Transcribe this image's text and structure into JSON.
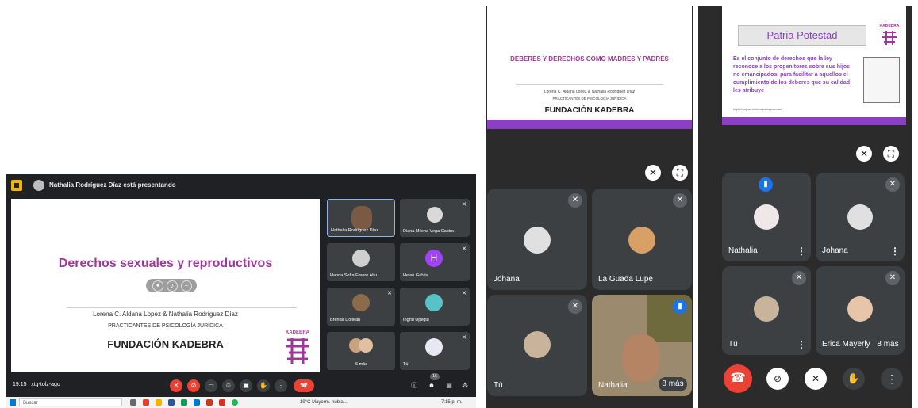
{
  "panel1": {
    "presenting_text": "Nathalia Rodríguez Díaz está presentando",
    "slide": {
      "title": "Derechos sexuales y reproductivos",
      "authors": "Lorena C. Aldana Lopez & Nathalia Rodríguez Díaz",
      "subtitle": "PRACTICANTES DE PSICOLOGÍA JURÍDICA",
      "foundation": "FUNDACIÓN KADEBRA",
      "logo_text": "KADEBRA"
    },
    "participants": [
      {
        "name": "Nathalia Rodríguez Díaz"
      },
      {
        "name": "Diana Milena Vega Castro"
      },
      {
        "name": "Hanna Sofía Forero Ahu..."
      },
      {
        "name": "Helen Galvis",
        "initial": "H"
      },
      {
        "name": "Brenda Doitean"
      },
      {
        "name": "Ingrid Upegui"
      },
      {
        "name": "6 más"
      },
      {
        "name": "Tú"
      }
    ],
    "bottom_bar": {
      "time_meeting": "19:15 | xtg-tolz-ago",
      "badge": "16"
    },
    "taskbar": {
      "search": "Buscar",
      "weather": "19°C Mayorm. nubla...",
      "clock": "7:15 p. m."
    }
  },
  "panel2": {
    "slide": {
      "title": "DEBERES Y DERECHOS COMO MADRES Y PADRES",
      "authors": "Lorena C. Aldana Lopez & Nathalia Rodríguez Díaz",
      "subtitle": "PRACTICANTES DE PSICOLOGÍA JURÍDICA",
      "foundation": "FUNDACIÓN KADEBRA"
    },
    "tiles": [
      {
        "name": "Johana"
      },
      {
        "name": "La Guada Lupe"
      },
      {
        "name": "Tú"
      },
      {
        "name": "Nathalia"
      }
    ],
    "more": "8 más"
  },
  "panel3": {
    "slide": {
      "title": "Patria Potestad",
      "logo_text": "KADEBRA",
      "body": "Es el conjunto de derechos que la ley reconoce a los progenitores sobre sus hijos no emancipados, para facilitar a aquellos el cumplimiento de los deberes que su calidad les atribuye",
      "source": "https://dpej.rae.es/lema/patria-potestad"
    },
    "tiles": [
      {
        "name": "Nathalia"
      },
      {
        "name": "Johana"
      },
      {
        "name": "Tú"
      },
      {
        "name": "Erica Mayerly"
      }
    ],
    "more": "8 más"
  },
  "colors": {
    "brand_purple": "#a0379c",
    "end_call_red": "#ea4335",
    "meet_dark": "#202124"
  }
}
